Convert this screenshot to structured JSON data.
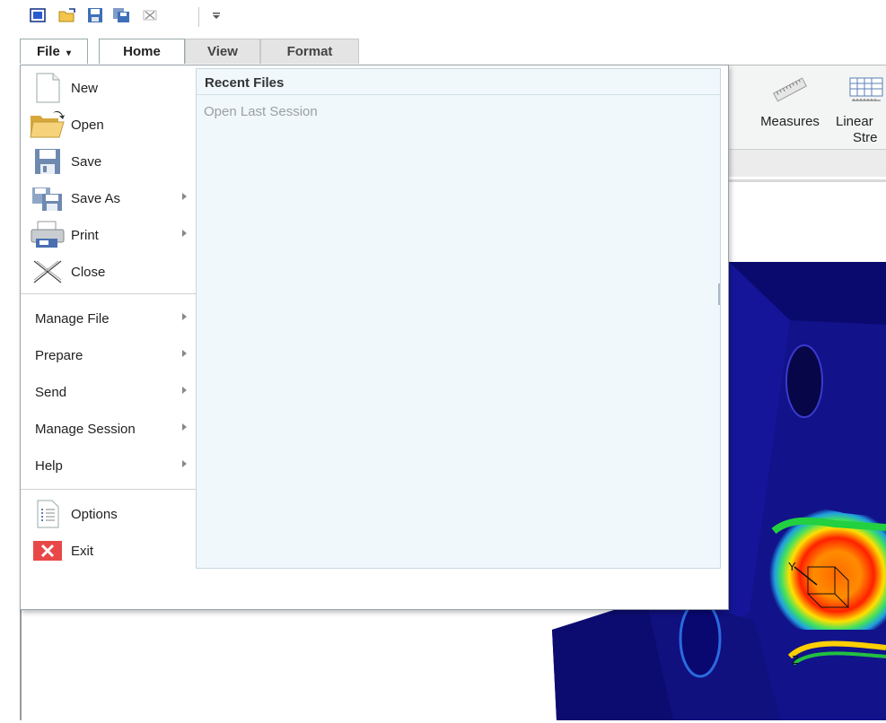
{
  "quick_access": {
    "icons": [
      "window-icon",
      "open-folder-icon",
      "save-icon",
      "save-as-icon",
      "close-window-icon",
      "customize-dropdown-icon"
    ]
  },
  "tabs": {
    "file": "File",
    "home": "Home",
    "view": "View",
    "format": "Format"
  },
  "ribbon": {
    "measures": "Measures",
    "linear_stress_line1": "Linear",
    "linear_stress_line2": "Stre"
  },
  "file_menu": {
    "items": [
      {
        "label": "New",
        "icon": "new-file-icon",
        "has_submenu": false
      },
      {
        "label": "Open",
        "icon": "open-folder-icon",
        "has_submenu": false
      },
      {
        "label": "Save",
        "icon": "save-icon",
        "has_submenu": false
      },
      {
        "label": "Save As",
        "icon": "save-as-icon",
        "has_submenu": true
      },
      {
        "label": "Print",
        "icon": "printer-icon",
        "has_submenu": true
      },
      {
        "label": "Close",
        "icon": "close-x-icon",
        "has_submenu": false
      }
    ],
    "submenus": [
      {
        "label": "Manage File",
        "has_submenu": true
      },
      {
        "label": "Prepare",
        "has_submenu": true
      },
      {
        "label": "Send",
        "has_submenu": true
      },
      {
        "label": "Manage Session",
        "has_submenu": true
      },
      {
        "label": "Help",
        "has_submenu": true
      }
    ],
    "footer": [
      {
        "label": "Options",
        "icon": "options-list-icon"
      },
      {
        "label": "Exit",
        "icon": "exit-icon"
      }
    ]
  },
  "recent_files": {
    "title": "Recent Files",
    "open_last_session": "Open Last Session"
  },
  "colors": {
    "accent": "#e04848",
    "recent_bg": "#f0f8fc",
    "model_blue": "#12128a"
  }
}
